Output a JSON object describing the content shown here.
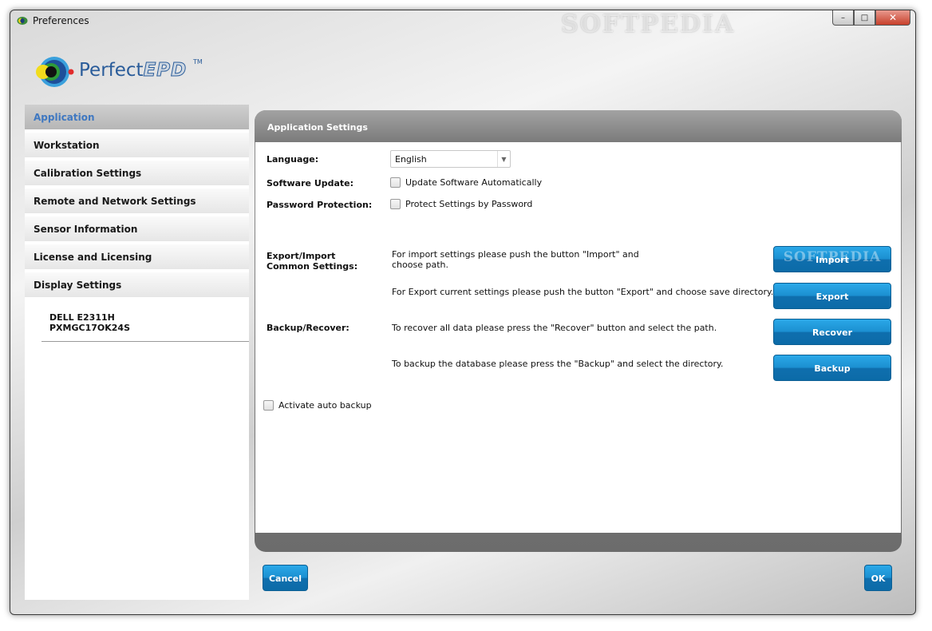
{
  "window": {
    "title": "Preferences",
    "watermark": "SOFTPEDIA",
    "controls": {
      "minimize": "–",
      "maximize": "□",
      "close": "✕"
    }
  },
  "logo": {
    "name": "Perfect",
    "suffix": "EPD",
    "tm": "TM"
  },
  "sidebar": {
    "items": [
      {
        "label": "Application",
        "active": true
      },
      {
        "label": "Workstation",
        "active": false
      },
      {
        "label": "Calibration Settings",
        "active": false
      },
      {
        "label": "Remote and Network Settings",
        "active": false
      },
      {
        "label": "Sensor Information",
        "active": false
      },
      {
        "label": "License and Licensing",
        "active": false
      },
      {
        "label": "Display Settings",
        "active": false
      }
    ],
    "display": {
      "model": "DELL E2311H",
      "serial": "PXMGC17OK24S"
    }
  },
  "panel": {
    "title": "Application Settings",
    "language": {
      "label": "Language:",
      "value": "English"
    },
    "software_update": {
      "label": "Software Update:",
      "checkbox_label": "Update Software Automatically",
      "checked": false
    },
    "password": {
      "label": "Password Protection:",
      "checkbox_label": "Protect Settings by Password",
      "checked": false
    },
    "export_import": {
      "label_line1": "Export/Import",
      "label_line2": "Common Settings:",
      "import_desc_1": "For import settings please push the button \"Import\" and",
      "import_desc_2": "choose path.",
      "export_desc": "For Export current settings please push the button \"Export\" and choose save directory.",
      "import_button": "Import",
      "export_button": "Export",
      "import_watermark": "SOFTPEDIA"
    },
    "backup": {
      "label": "Backup/Recover:",
      "recover_desc": "To recover all data please press the \"Recover\" button and select the path.",
      "backup_desc": "To backup the database please press the \"Backup\" and select the directory.",
      "recover_button": "Recover",
      "backup_button": "Backup"
    },
    "auto_backup": {
      "label": "Activate auto backup",
      "checked": false
    }
  },
  "footer": {
    "cancel": "Cancel",
    "ok": "OK"
  },
  "colors": {
    "accent_blue": "#1b8fd0",
    "active_text": "#3f78c1"
  }
}
